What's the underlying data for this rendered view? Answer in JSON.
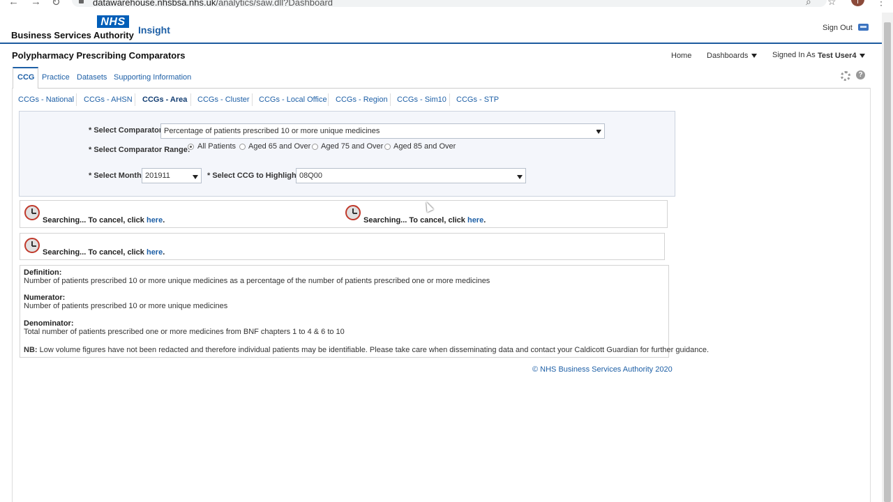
{
  "browser": {
    "url_prefix": "datawarehouse.nhsbsa.nhs.uk",
    "url_path": "/analytics/saw.dll?Dashboard",
    "avatar_letter": "T"
  },
  "header": {
    "logo_mark": "NHS",
    "org_name": "Business Services Authority",
    "app_name": "Insight",
    "sign_out": "Sign Out"
  },
  "page": {
    "title": "Polypharmacy Prescribing Comparators",
    "nav": {
      "home": "Home",
      "dashboards": "Dashboards",
      "signed_in_as": "Signed In As",
      "user": "Test User4"
    }
  },
  "tabs": [
    {
      "label": "CCG",
      "active": true
    },
    {
      "label": "Practice"
    },
    {
      "label": "Datasets"
    },
    {
      "label": "Supporting Information"
    }
  ],
  "subtabs": [
    {
      "label": "CCGs - National"
    },
    {
      "label": "CCGs - AHSN"
    },
    {
      "label": "CCGs - Area",
      "active": true
    },
    {
      "label": "CCGs - Cluster"
    },
    {
      "label": "CCGs - Local Office"
    },
    {
      "label": "CCGs - Region"
    },
    {
      "label": "CCGs - Sim10"
    },
    {
      "label": "CCGs - STP"
    }
  ],
  "prompts": {
    "comparator_label": "* Select Comparator:",
    "comparator_value": "Percentage of patients prescribed 10 or more unique medicines",
    "range_label": "* Select Comparator Range:",
    "range_options": [
      "All Patients",
      "Aged 65 and Over",
      "Aged 75 and Over",
      "Aged 85 and Over"
    ],
    "range_selected": "All Patients",
    "month_label": "* Select Month:",
    "month_value": "201911",
    "ccg_label": "* Select CCG to Highlight:",
    "ccg_value": "08Q00"
  },
  "search": {
    "text": "Searching... To cancel, click ",
    "link": "here",
    "dot": "."
  },
  "definition": {
    "definition_label": "Definition:",
    "definition_text": "Number of patients prescribed 10 or more unique medicines as a percentage of the number of patients prescribed one or more medicines",
    "numerator_label": "Numerator:",
    "numerator_text": "Number of patients prescribed 10 or more unique medicines",
    "denominator_label": "Denominator:",
    "denominator_text": "Total number of patients prescribed one or more medicines from BNF chapters 1 to 4 & 6 to 10",
    "nb_label": "NB:",
    "nb_text": " Low volume figures have not been redacted and therefore individual patients may be identifiable. Please take care when disseminating data and contact your Caldicott Guardian for further guidance."
  },
  "footer": "© NHS Business Services Authority 2020"
}
